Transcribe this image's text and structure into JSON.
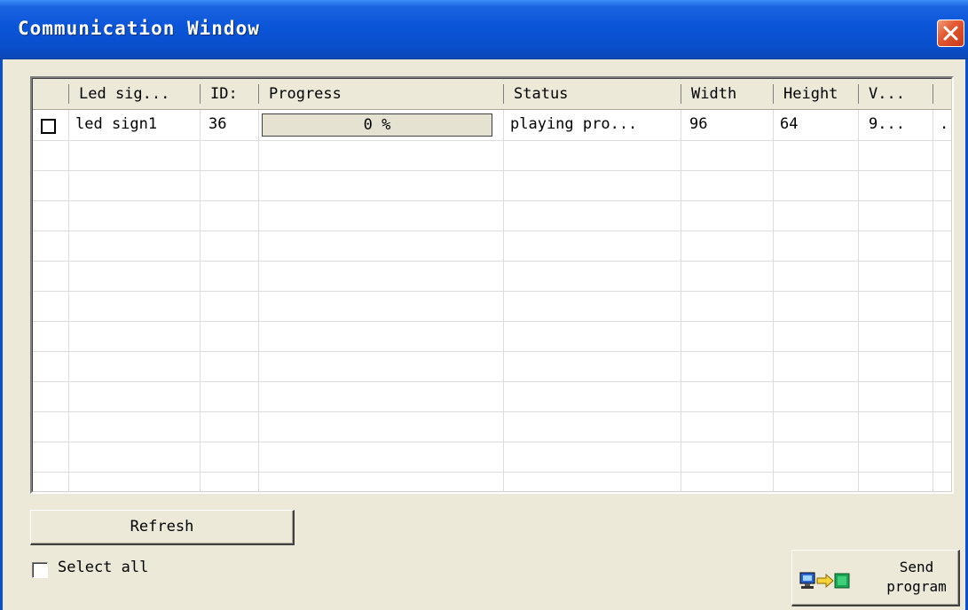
{
  "window": {
    "title": "Communication Window"
  },
  "table": {
    "headers": [
      "Led sig...",
      "ID:",
      "Progress",
      "Status",
      "Width",
      "Height",
      "V..."
    ],
    "rows": [
      {
        "checked": false,
        "name": "led sign1",
        "id": "36",
        "progress_text": "0 %",
        "progress": 0,
        "status": "playing pro...",
        "width": "96",
        "height": "64",
        "version": "9...",
        "extra": "."
      }
    ]
  },
  "buttons": {
    "refresh": "Refresh",
    "send_line1": "Send",
    "send_line2": "program"
  },
  "select_all": {
    "label": "Select all",
    "checked": false
  },
  "icons": {
    "close": "close-icon",
    "send": "send-program-icon"
  },
  "colors": {
    "title_bar": "#0a55d8",
    "close": "#e25a32",
    "face": "#ece9d8"
  }
}
